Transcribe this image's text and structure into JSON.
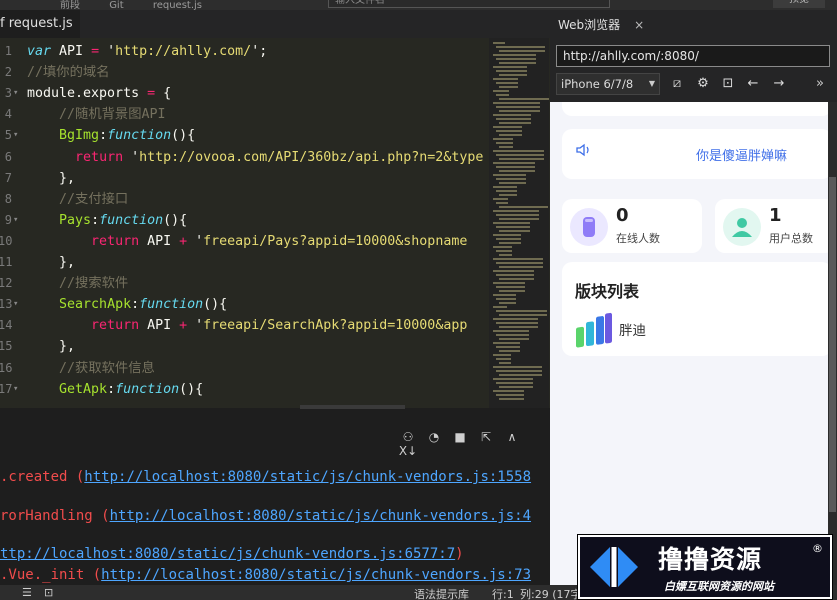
{
  "top_menu": {
    "items": [
      "前段",
      "Git",
      "request.js"
    ],
    "search_text": "输入文件名",
    "button_label": "预览"
  },
  "editor": {
    "tab_label": "request.js",
    "lines": [
      {
        "n": "1",
        "fold": "",
        "segs": [
          [
            "kw",
            "var"
          ],
          [
            "txt",
            " API "
          ],
          [
            "op",
            "="
          ],
          [
            "txt",
            " '"
          ],
          [
            "str",
            "http://ahlly.com/"
          ],
          [
            "txt",
            "';"
          ]
        ]
      },
      {
        "n": "2",
        "fold": "",
        "segs": [
          [
            "cmt",
            "//填你的域名"
          ]
        ]
      },
      {
        "n": "3",
        "fold": "▾",
        "segs": [
          [
            "txt",
            "module.exports "
          ],
          [
            "op",
            "="
          ],
          [
            "txt",
            " {"
          ]
        ]
      },
      {
        "n": "4",
        "fold": "",
        "segs": [
          [
            "txt",
            "    "
          ],
          [
            "cmt",
            "//随机背景图API"
          ]
        ]
      },
      {
        "n": "5",
        "fold": "▾",
        "segs": [
          [
            "txt",
            "    "
          ],
          [
            "fn",
            "BgImg"
          ],
          [
            "txt",
            ":"
          ],
          [
            "kw",
            "function"
          ],
          [
            "txt",
            "(){"
          ]
        ]
      },
      {
        "n": "6",
        "fold": "",
        "segs": [
          [
            "txt",
            "      "
          ],
          [
            "op",
            "return"
          ],
          [
            "txt",
            " '"
          ],
          [
            "str",
            "http://ovooa.com/API/360bz/api.php?n=2&type"
          ]
        ]
      },
      {
        "n": "7",
        "fold": "",
        "segs": [
          [
            "txt",
            "    },"
          ]
        ]
      },
      {
        "n": "8",
        "fold": "",
        "segs": [
          [
            "txt",
            "    "
          ],
          [
            "cmt",
            "//支付接口"
          ]
        ]
      },
      {
        "n": "9",
        "fold": "▾",
        "segs": [
          [
            "txt",
            "    "
          ],
          [
            "fn",
            "Pays"
          ],
          [
            "txt",
            ":"
          ],
          [
            "kw",
            "function"
          ],
          [
            "txt",
            "(){"
          ]
        ]
      },
      {
        "n": "10",
        "fold": "",
        "segs": [
          [
            "txt",
            "        "
          ],
          [
            "op",
            "return"
          ],
          [
            "txt",
            " API "
          ],
          [
            "op",
            "+"
          ],
          [
            "txt",
            " '"
          ],
          [
            "str",
            "freeapi/Pays?appid=10000&shopname"
          ]
        ]
      },
      {
        "n": "11",
        "fold": "",
        "segs": [
          [
            "txt",
            "    },"
          ]
        ]
      },
      {
        "n": "12",
        "fold": "",
        "segs": [
          [
            "txt",
            "    "
          ],
          [
            "cmt",
            "//搜索软件"
          ]
        ]
      },
      {
        "n": "13",
        "fold": "▾",
        "segs": [
          [
            "txt",
            "    "
          ],
          [
            "fn",
            "SearchApk"
          ],
          [
            "txt",
            ":"
          ],
          [
            "kw",
            "function"
          ],
          [
            "txt",
            "(){"
          ]
        ]
      },
      {
        "n": "14",
        "fold": "",
        "segs": [
          [
            "txt",
            "        "
          ],
          [
            "op",
            "return"
          ],
          [
            "txt",
            " API "
          ],
          [
            "op",
            "+"
          ],
          [
            "txt",
            " '"
          ],
          [
            "str",
            "freeapi/SearchApk?appid=10000&app"
          ]
        ]
      },
      {
        "n": "15",
        "fold": "",
        "segs": [
          [
            "txt",
            "    },"
          ]
        ]
      },
      {
        "n": "16",
        "fold": "",
        "segs": [
          [
            "txt",
            "    "
          ],
          [
            "cmt",
            "//获取软件信息"
          ]
        ]
      },
      {
        "n": "17",
        "fold": "▾",
        "segs": [
          [
            "txt",
            "    "
          ],
          [
            "fn",
            "GetApk"
          ],
          [
            "txt",
            ":"
          ],
          [
            "kw",
            "function"
          ],
          [
            "txt",
            "(){"
          ]
        ]
      }
    ]
  },
  "console": {
    "tools": [
      "debug-icon",
      "timer-icon",
      "stop-icon",
      "export-icon",
      "collapse-up-icon",
      "close-panel-icon"
    ],
    "tool_glyphs": [
      "⚇",
      "◔",
      "■",
      "⇱",
      "∧",
      "X↓"
    ],
    "lines": [
      {
        "pre": ".created (",
        "link": "http://localhost:8080/static/js/chunk-vendors.js:1558",
        "post": ""
      },
      {
        "pre": "rorHandling (",
        "link": "http://localhost:8080/static/js/chunk-vendors.js:4",
        "post": ""
      },
      {
        "pre": "",
        "link": "ttp://localhost:8080/static/js/chunk-vendors.js:6577:7",
        "post": ")"
      },
      {
        "pre": ".Vue._init (",
        "link": "http://localhost:8080/static/js/chunk-vendors.js:73",
        "post": ""
      }
    ]
  },
  "statusbar": {
    "left_icons": [
      "☰",
      "⊡"
    ],
    "syntax_hint": "语法提示库",
    "row": "行:1",
    "col": "列:29 (17字"
  },
  "browser": {
    "tab_label": "Web浏览器",
    "close_glyph": "×",
    "url": "http://ahlly.com/:8080/",
    "device": "iPhone 6/7/8",
    "tool_glyphs": [
      "⧄",
      "⚙",
      "⊡",
      "←",
      "→"
    ],
    "more_glyph": "»",
    "page": {
      "notice_icon": "🔈",
      "notice_text": "你是傻逼胖婵嘛",
      "stats": [
        {
          "value": "0",
          "label": "在线人数",
          "color": "#8f7cf7",
          "bg": "#ebe8ff"
        },
        {
          "value": "1",
          "label": "用户总数",
          "color": "#3fc9a3",
          "bg": "#e2f7f0"
        }
      ],
      "block_title": "版块列表",
      "block_item": "胖迪"
    }
  },
  "watermark": {
    "title": "撸撸资源",
    "reg": "®",
    "subtitle": "白嫖互联网资源的网站"
  }
}
